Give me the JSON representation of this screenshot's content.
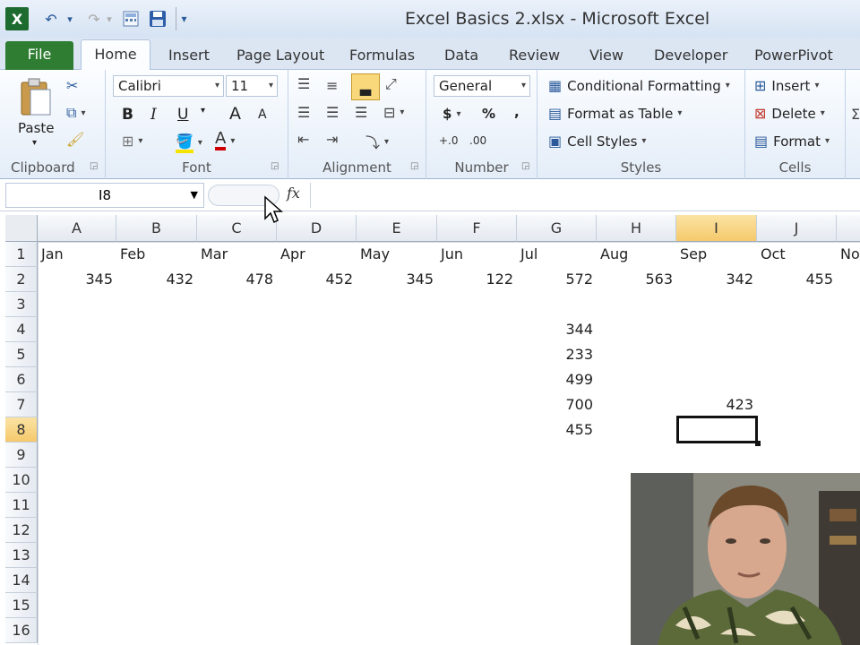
{
  "window": {
    "title": "Excel Basics 2.xlsx - Microsoft Excel",
    "app_icon": "X"
  },
  "quick_access": {
    "undo_icon": "↶",
    "redo_icon": "↷",
    "dropdown_icon": "▾"
  },
  "tabs": {
    "file": "File",
    "home": "Home",
    "insert": "Insert",
    "page_layout": "Page Layout",
    "formulas": "Formulas",
    "data": "Data",
    "review": "Review",
    "view": "View",
    "developer": "Developer",
    "powerpivot": "PowerPivot"
  },
  "ribbon": {
    "clipboard": {
      "label": "Clipboard",
      "paste": "Paste"
    },
    "font": {
      "label": "Font",
      "name": "Calibri",
      "size": "11",
      "bold": "B",
      "italic": "I",
      "underline": "U",
      "grow": "A",
      "shrink": "A"
    },
    "alignment": {
      "label": "Alignment"
    },
    "number": {
      "label": "Number",
      "format": "General",
      "currency": "$",
      "percent": "%",
      "comma": ",",
      "inc_decimal": "+.0",
      "dec_decimal": ".00"
    },
    "styles": {
      "label": "Styles",
      "conditional": "Conditional Formatting",
      "format_table": "Format as Table",
      "cell_styles": "Cell Styles"
    },
    "cells": {
      "label": "Cells",
      "insert": "Insert",
      "delete": "Delete",
      "format": "Format"
    }
  },
  "formula_bar": {
    "name_box": "I8",
    "fx": "fx",
    "value": ""
  },
  "columns": [
    "A",
    "B",
    "C",
    "D",
    "E",
    "F",
    "G",
    "H",
    "I",
    "J"
  ],
  "rows": [
    "1",
    "2",
    "3",
    "4",
    "5",
    "6",
    "7",
    "8",
    "9",
    "10",
    "11",
    "12",
    "13",
    "14",
    "15",
    "16"
  ],
  "cells": {
    "row1": [
      "Jan",
      "Feb",
      "Mar",
      "Apr",
      "May",
      "Jun",
      "Jul",
      "Aug",
      "Sep",
      "Oct",
      "No"
    ],
    "row2": [
      "345",
      "432",
      "478",
      "452",
      "345",
      "122",
      "572",
      "563",
      "342",
      "455"
    ],
    "G4": "344",
    "G5": "233",
    "G6": "499",
    "G7": "700",
    "G8": "455",
    "I7": "423"
  },
  "colors": {
    "file_tab": "#2e7d32",
    "selection_header": "#f5c96c",
    "accent": "#2a5a9a"
  }
}
